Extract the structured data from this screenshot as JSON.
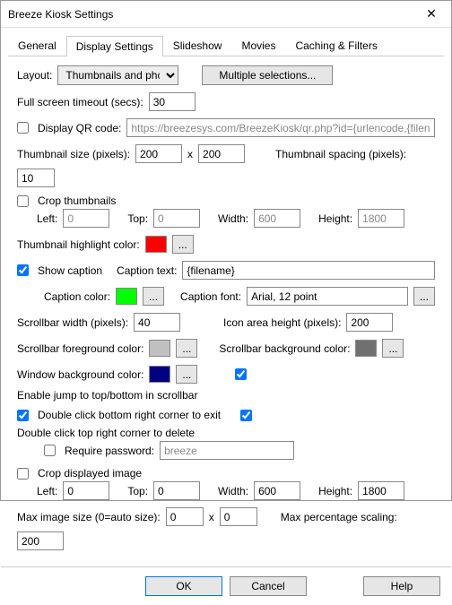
{
  "window": {
    "title": "Breeze Kiosk Settings",
    "close": "✕"
  },
  "tabs": {
    "general": "General",
    "display": "Display Settings",
    "slideshow": "Slideshow",
    "movies": "Movies",
    "caching": "Caching & Filters"
  },
  "layout": {
    "label": "Layout:",
    "value": "Thumbnails and photo",
    "multiple": "Multiple selections..."
  },
  "fullscreen": {
    "label": "Full screen timeout (secs):",
    "value": "30"
  },
  "qr": {
    "label": "Display QR code:",
    "url": "https://breezesys.com/BreezeKiosk/qr.php?id={urlencode,{filename}}"
  },
  "thumb": {
    "size_label": "Thumbnail size (pixels):",
    "w": "200",
    "x": "x",
    "h": "200",
    "spacing_label": "Thumbnail spacing (pixels):",
    "spacing": "10"
  },
  "crop_thumb": {
    "label": "Crop thumbnails",
    "left_l": "Left:",
    "left": "0",
    "top_l": "Top:",
    "top": "0",
    "width_l": "Width:",
    "width": "600",
    "height_l": "Height:",
    "height": "1800"
  },
  "highlight": {
    "label": "Thumbnail highlight color:",
    "color": "#ff0000",
    "dots": "..."
  },
  "caption": {
    "show": "Show caption",
    "text_l": "Caption text:",
    "text": "{filename}",
    "color_l": "Caption color:",
    "color": "#00ff00",
    "font_l": "Caption font:",
    "font": "Arial, 12 point",
    "dots": "..."
  },
  "scrollbar": {
    "width_l": "Scrollbar width (pixels):",
    "width": "40",
    "icon_l": "Icon area height (pixels):",
    "icon": "200",
    "fg_l": "Scrollbar foreground color:",
    "fg": "#c0c0c0",
    "bg_l": "Scrollbar background color:",
    "bg": "#707070"
  },
  "winbg": {
    "label": "Window background color:",
    "color": "#000080",
    "jump": "Enable jump to top/bottom in scrollbar"
  },
  "dbl": {
    "exit": "Double click bottom right corner to exit",
    "delete": "Double click top right corner to delete",
    "reqpw_l": "Require password:",
    "reqpw": "breeze"
  },
  "crop_disp": {
    "label": "Crop displayed image",
    "left_l": "Left:",
    "left": "0",
    "top_l": "Top:",
    "top": "0",
    "width_l": "Width:",
    "width": "600",
    "height_l": "Height:",
    "height": "1800"
  },
  "maximg": {
    "label": "Max image size (0=auto size):",
    "w": "0",
    "x": "x",
    "h": "0",
    "scale_l": "Max percentage scaling:",
    "scale": "200"
  },
  "footer": {
    "ok": "OK",
    "cancel": "Cancel",
    "help": "Help"
  }
}
